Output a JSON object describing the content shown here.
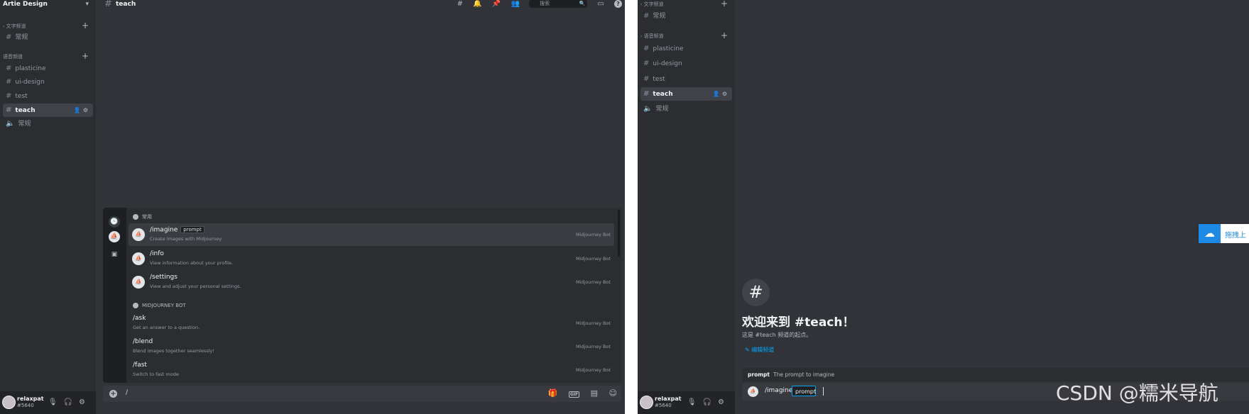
{
  "left": {
    "server_name": "Artie Design",
    "text_category": "文字频道",
    "voice_category": "语音频道",
    "text_channels": [
      {
        "label": "常规"
      }
    ],
    "voice_channels": [
      {
        "label": "plasticine"
      },
      {
        "label": "ui-design"
      },
      {
        "label": "test"
      },
      {
        "label": "teach"
      },
      {
        "label": "常规"
      }
    ],
    "user": {
      "name": "relaxpat",
      "tag": "#5640"
    },
    "channel_title": "teach",
    "search_placeholder": "搜索",
    "popup": {
      "frequent_label": "常用",
      "bot_section_label": "MIDJOURNEY BOT",
      "frequent_commands": [
        {
          "name": "/imagine",
          "option": "prompt",
          "desc": "Create images with Midjourney",
          "bot": "Midjourney Bot"
        },
        {
          "name": "/info",
          "desc": "View information about your profile.",
          "bot": "Midjourney Bot"
        },
        {
          "name": "/settings",
          "desc": "View and adjust your personal settings.",
          "bot": "Midjourney Bot"
        }
      ],
      "bot_commands": [
        {
          "name": "/ask",
          "desc": "Get an answer to a question.",
          "bot": "Midjourney Bot"
        },
        {
          "name": "/blend",
          "desc": "Blend images together seamlessly!",
          "bot": "Midjourney Bot"
        },
        {
          "name": "/fast",
          "desc": "Switch to fast mode",
          "bot": "Midjourney Bot"
        }
      ]
    },
    "composer_text": "/",
    "gif_label": "GIF"
  },
  "right": {
    "text_category": "文字频道",
    "voice_category": "语音频道",
    "text_channels": [
      {
        "label": "常规"
      }
    ],
    "voice_channels": [
      {
        "label": "plasticine"
      },
      {
        "label": "ui-design"
      },
      {
        "label": "test"
      },
      {
        "label": "teach"
      },
      {
        "label": "常规"
      }
    ],
    "user": {
      "name": "relaxpat",
      "tag": "#5640"
    },
    "welcome_title": "欢迎来到 #teach！",
    "welcome_sub": "这是 #teach 频道的起点。",
    "edit_channel": "编辑频道",
    "hint_param": "prompt",
    "hint_desc": "The prompt to imagine",
    "composer_cmd": "/imagine",
    "composer_opt": "prompt"
  },
  "cloud_widget_text": "拖拽上",
  "watermark": "CSDN @糯米导航",
  "colors": {
    "bg_main": "#313338",
    "bg_sidebar": "#2b2d31",
    "accent_link": "#00a8fc",
    "widget_blue": "#1e88e5"
  }
}
